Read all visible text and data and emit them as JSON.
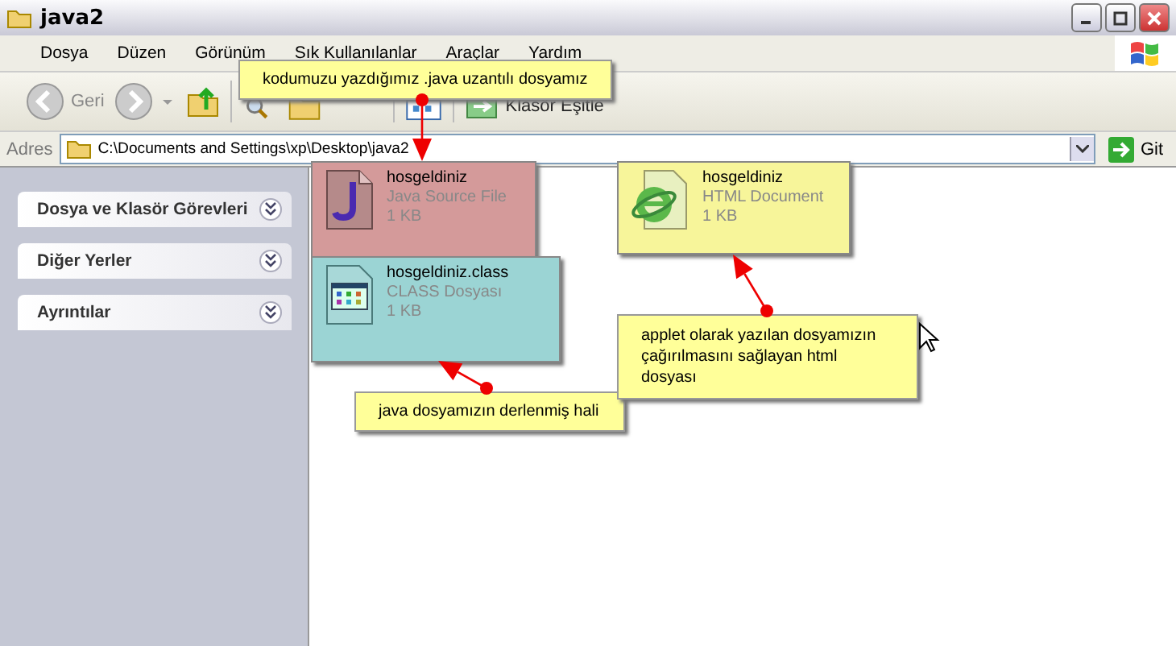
{
  "window": {
    "title": "java2"
  },
  "menu": [
    "Dosya",
    "Düzen",
    "Görünüm",
    "Sık Kullanılanlar",
    "Araçlar",
    "Yardım"
  ],
  "toolbar": {
    "back": "Geri",
    "sync": "Klasör Eşitle"
  },
  "address": {
    "label": "Adres",
    "value": "C:\\Documents and Settings\\xp\\Desktop\\java2",
    "go": "Git"
  },
  "sidebar": {
    "panels": [
      {
        "title": "Dosya ve Klasör Görevleri",
        "expanded": false
      },
      {
        "title": "Diğer Yerler",
        "expanded": false
      },
      {
        "title": "Ayrıntılar",
        "expanded": false
      }
    ]
  },
  "files": [
    {
      "name": "hosgeldiniz",
      "type": "Java Source File",
      "size": "1 KB",
      "kind": "java",
      "color": "#d49a9a"
    },
    {
      "name": "hosgeldiniz.class",
      "type": "CLASS Dosyası",
      "size": "1 KB",
      "kind": "class",
      "color": "#9bd4d4"
    },
    {
      "name": "hosgeldiniz",
      "type": "HTML Document",
      "size": "1 KB",
      "kind": "html",
      "color": "#f7f59a"
    }
  ],
  "callouts": [
    {
      "text": "kodumuzu yazdığımız .java uzantılı dosyamız"
    },
    {
      "text": "java dosyamızın derlenmiş hali"
    },
    {
      "text": "applet olarak yazılan dosyamızın çağırılmasını sağlayan html dosyası"
    }
  ]
}
